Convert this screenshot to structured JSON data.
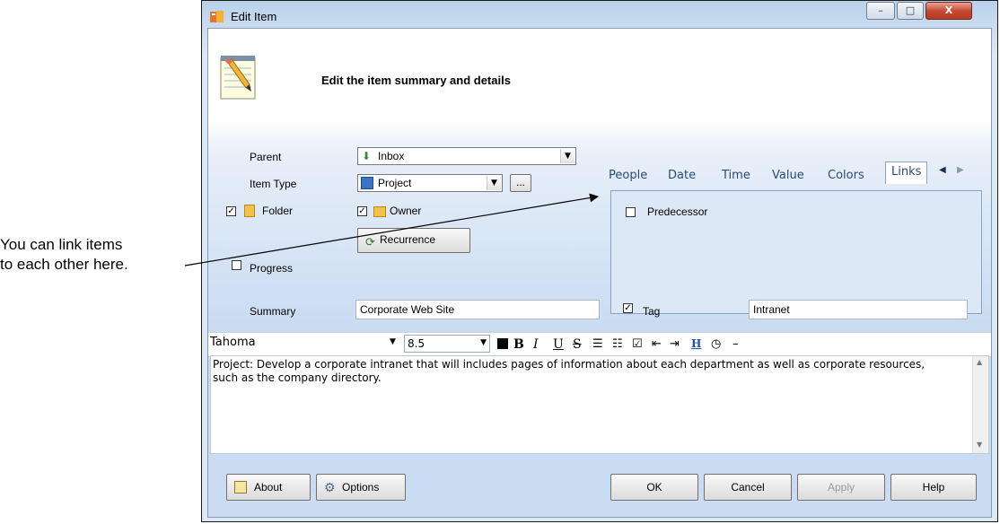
{
  "callout": {
    "line1": "You can link items",
    "line2": "to each other here."
  },
  "window": {
    "title": "Edit Item",
    "header": "Edit the item summary and details",
    "buttons": {
      "minimize": "–",
      "maximize": "□",
      "close": "X"
    }
  },
  "form": {
    "parent_label": "Parent",
    "parent_value": "Inbox",
    "item_type_label": "Item Type",
    "item_type_value": "Project",
    "ellipsis_label": "...",
    "folder_label": "Folder",
    "owner_label": "Owner",
    "recurrence_label": "Recurrence",
    "progress_label": "Progress",
    "summary_label": "Summary",
    "summary_value": "Corporate Web Site",
    "tag_label": "Tag",
    "tag_value": "Intranet",
    "folder_checked": true,
    "owner_checked": true,
    "tag_checked": true,
    "progress_checked": false
  },
  "tabs": {
    "items": [
      "People",
      "Date",
      "Time",
      "Value",
      "Colors",
      "Links"
    ],
    "active": "Links",
    "predecessor_label": "Predecessor"
  },
  "toolbar": {
    "font": "Tahoma",
    "size": "8.5",
    "bold": "B",
    "italic": "I",
    "underline": "U",
    "strike": "S",
    "heading": "H"
  },
  "editor": {
    "text": "Project: Develop a corporate intranet that will includes pages of information about each department as well as corporate resources, such as the company directory."
  },
  "footer": {
    "about": "About",
    "options": "Options",
    "ok": "OK",
    "cancel": "Cancel",
    "apply": "Apply",
    "help": "Help"
  }
}
